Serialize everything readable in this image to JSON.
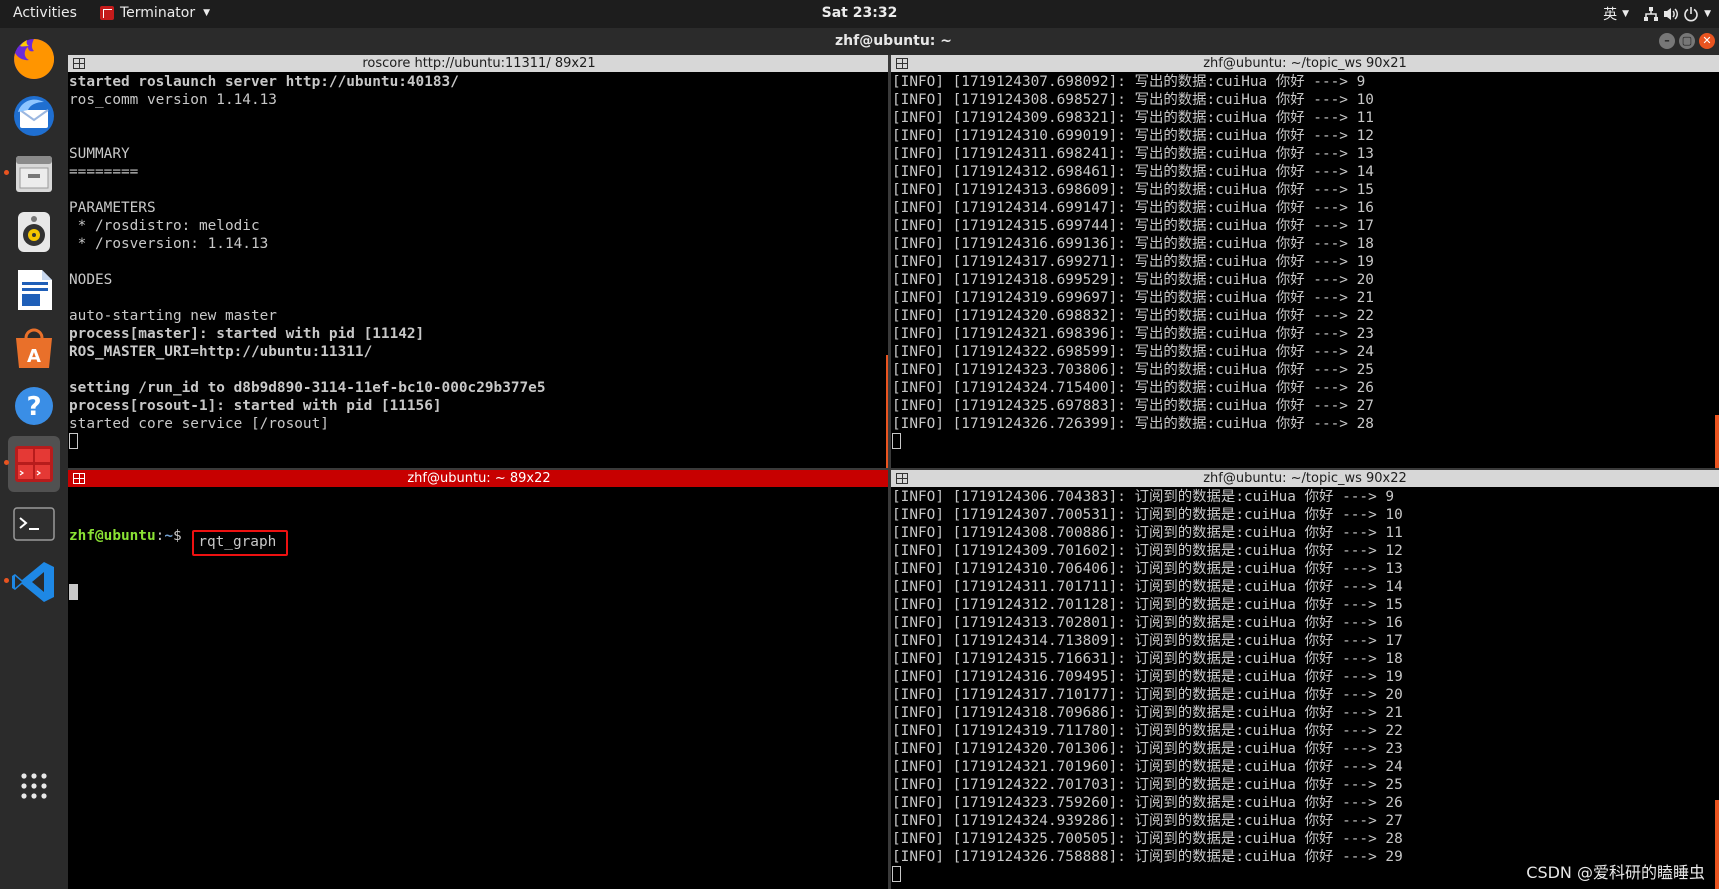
{
  "topbar": {
    "activities": "Activities",
    "app_name": "Terminator",
    "clock": "Sat 23:32",
    "input_method": "英"
  },
  "window": {
    "title": "zhf@ubuntu: ~"
  },
  "panes": {
    "top_left": {
      "title": "roscore http://ubuntu:11311/ 89x21",
      "lines": [
        "started roslaunch server http://ubuntu:40183/",
        "ros_comm version 1.14.13",
        "",
        "",
        "SUMMARY",
        "========",
        "",
        "PARAMETERS",
        " * /rosdistro: melodic",
        " * /rosversion: 1.14.13",
        "",
        "NODES",
        "",
        "auto-starting new master",
        "process[master]: started with pid [11142]",
        "ROS_MASTER_URI=http://ubuntu:11311/",
        "",
        "setting /run_id to d8b9d890-3114-11ef-bc10-000c29b377e5",
        "process[rosout-1]: started with pid [11156]",
        "started core service [/rosout]"
      ]
    },
    "top_right": {
      "title": "zhf@ubuntu: ~/topic_ws 90x21",
      "lines": [
        "[INFO] [1719124307.698092]: 写出的数据:cuiHua 你好 ---> 9",
        "[INFO] [1719124308.698527]: 写出的数据:cuiHua 你好 ---> 10",
        "[INFO] [1719124309.698321]: 写出的数据:cuiHua 你好 ---> 11",
        "[INFO] [1719124310.699019]: 写出的数据:cuiHua 你好 ---> 12",
        "[INFO] [1719124311.698241]: 写出的数据:cuiHua 你好 ---> 13",
        "[INFO] [1719124312.698461]: 写出的数据:cuiHua 你好 ---> 14",
        "[INFO] [1719124313.698609]: 写出的数据:cuiHua 你好 ---> 15",
        "[INFO] [1719124314.699147]: 写出的数据:cuiHua 你好 ---> 16",
        "[INFO] [1719124315.699744]: 写出的数据:cuiHua 你好 ---> 17",
        "[INFO] [1719124316.699136]: 写出的数据:cuiHua 你好 ---> 18",
        "[INFO] [1719124317.699271]: 写出的数据:cuiHua 你好 ---> 19",
        "[INFO] [1719124318.699529]: 写出的数据:cuiHua 你好 ---> 20",
        "[INFO] [1719124319.699697]: 写出的数据:cuiHua 你好 ---> 21",
        "[INFO] [1719124320.698832]: 写出的数据:cuiHua 你好 ---> 22",
        "[INFO] [1719124321.698396]: 写出的数据:cuiHua 你好 ---> 23",
        "[INFO] [1719124322.698599]: 写出的数据:cuiHua 你好 ---> 24",
        "[INFO] [1719124323.703806]: 写出的数据:cuiHua 你好 ---> 25",
        "[INFO] [1719124324.715400]: 写出的数据:cuiHua 你好 ---> 26",
        "[INFO] [1719124325.697883]: 写出的数据:cuiHua 你好 ---> 27",
        "[INFO] [1719124326.726399]: 写出的数据:cuiHua 你好 ---> 28"
      ]
    },
    "bottom_left": {
      "title": "zhf@ubuntu: ~ 89x22",
      "prompt_user": "zhf@ubuntu",
      "prompt_sep": ":",
      "prompt_path": "~",
      "prompt_symbol": "$ ",
      "command": "rqt_graph"
    },
    "bottom_right": {
      "title": "zhf@ubuntu: ~/topic_ws 90x22",
      "lines": [
        "[INFO] [1719124306.704383]: 订阅到的数据是:cuiHua 你好 ---> 9",
        "[INFO] [1719124307.700531]: 订阅到的数据是:cuiHua 你好 ---> 10",
        "[INFO] [1719124308.700886]: 订阅到的数据是:cuiHua 你好 ---> 11",
        "[INFO] [1719124309.701602]: 订阅到的数据是:cuiHua 你好 ---> 12",
        "[INFO] [1719124310.706406]: 订阅到的数据是:cuiHua 你好 ---> 13",
        "[INFO] [1719124311.701711]: 订阅到的数据是:cuiHua 你好 ---> 14",
        "[INFO] [1719124312.701128]: 订阅到的数据是:cuiHua 你好 ---> 15",
        "[INFO] [1719124313.702801]: 订阅到的数据是:cuiHua 你好 ---> 16",
        "[INFO] [1719124314.713809]: 订阅到的数据是:cuiHua 你好 ---> 17",
        "[INFO] [1719124315.716631]: 订阅到的数据是:cuiHua 你好 ---> 18",
        "[INFO] [1719124316.709495]: 订阅到的数据是:cuiHua 你好 ---> 19",
        "[INFO] [1719124317.710177]: 订阅到的数据是:cuiHua 你好 ---> 20",
        "[INFO] [1719124318.709686]: 订阅到的数据是:cuiHua 你好 ---> 21",
        "[INFO] [1719124319.711780]: 订阅到的数据是:cuiHua 你好 ---> 22",
        "[INFO] [1719124320.701306]: 订阅到的数据是:cuiHua 你好 ---> 23",
        "[INFO] [1719124321.701960]: 订阅到的数据是:cuiHua 你好 ---> 24",
        "[INFO] [1719124322.701703]: 订阅到的数据是:cuiHua 你好 ---> 25",
        "[INFO] [1719124323.759260]: 订阅到的数据是:cuiHua 你好 ---> 26",
        "[INFO] [1719124324.939286]: 订阅到的数据是:cuiHua 你好 ---> 27",
        "[INFO] [1719124325.700505]: 订阅到的数据是:cuiHua 你好 ---> 28",
        "[INFO] [1719124326.758888]: 订阅到的数据是:cuiHua 你好 ---> 29"
      ]
    }
  },
  "dock": {
    "items": [
      {
        "icon": "firefox-icon"
      },
      {
        "icon": "thunderbird-icon"
      },
      {
        "icon": "files-icon"
      },
      {
        "icon": "rhythmbox-icon"
      },
      {
        "icon": "libreoffice-writer-icon"
      },
      {
        "icon": "software-center-icon"
      },
      {
        "icon": "help-icon"
      },
      {
        "icon": "terminator-icon"
      },
      {
        "icon": "terminal-icon"
      },
      {
        "icon": "vscode-icon"
      },
      {
        "icon": "show-apps-icon"
      }
    ]
  },
  "watermark": "CSDN @爱科研的瞌睡虫",
  "colors": {
    "accent": "#e95420",
    "active_pane_title": "#c70000",
    "prompt_user": "#8ae234",
    "prompt_path": "#729fcf",
    "highlight_box": "#ee1111"
  }
}
